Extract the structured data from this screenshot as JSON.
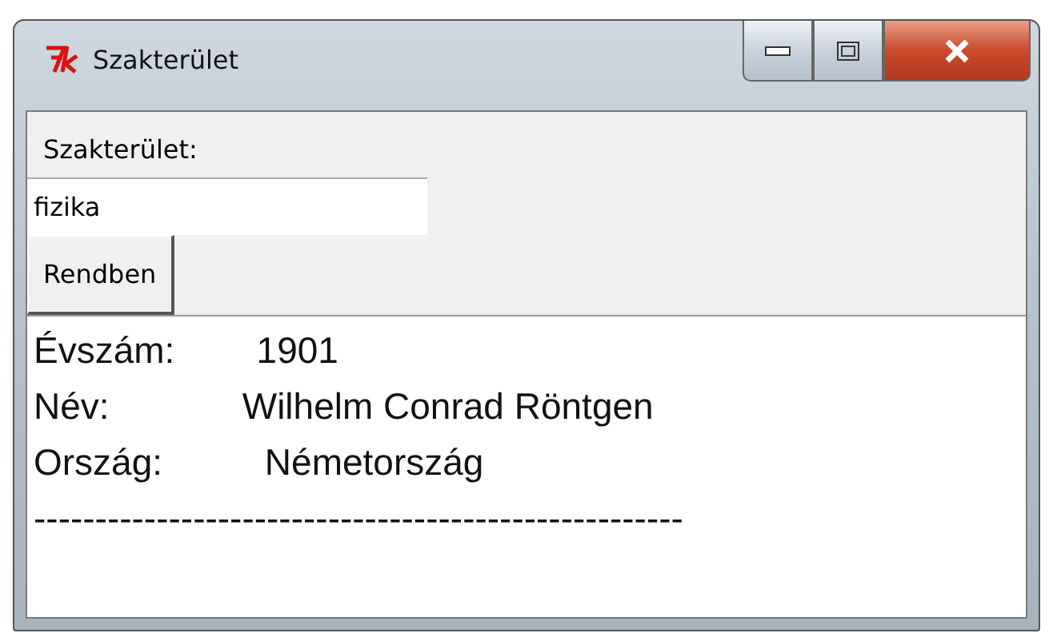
{
  "window": {
    "title": "Szakterület"
  },
  "form": {
    "label": "Szakterület:",
    "field_value": "fizika",
    "button": "Rendben"
  },
  "output": {
    "lines": [
      "Évszám:        1901",
      "Név:             Wilhelm Conrad Röntgen",
      "Ország:          Németország",
      "-----------------------------------------------------"
    ]
  }
}
